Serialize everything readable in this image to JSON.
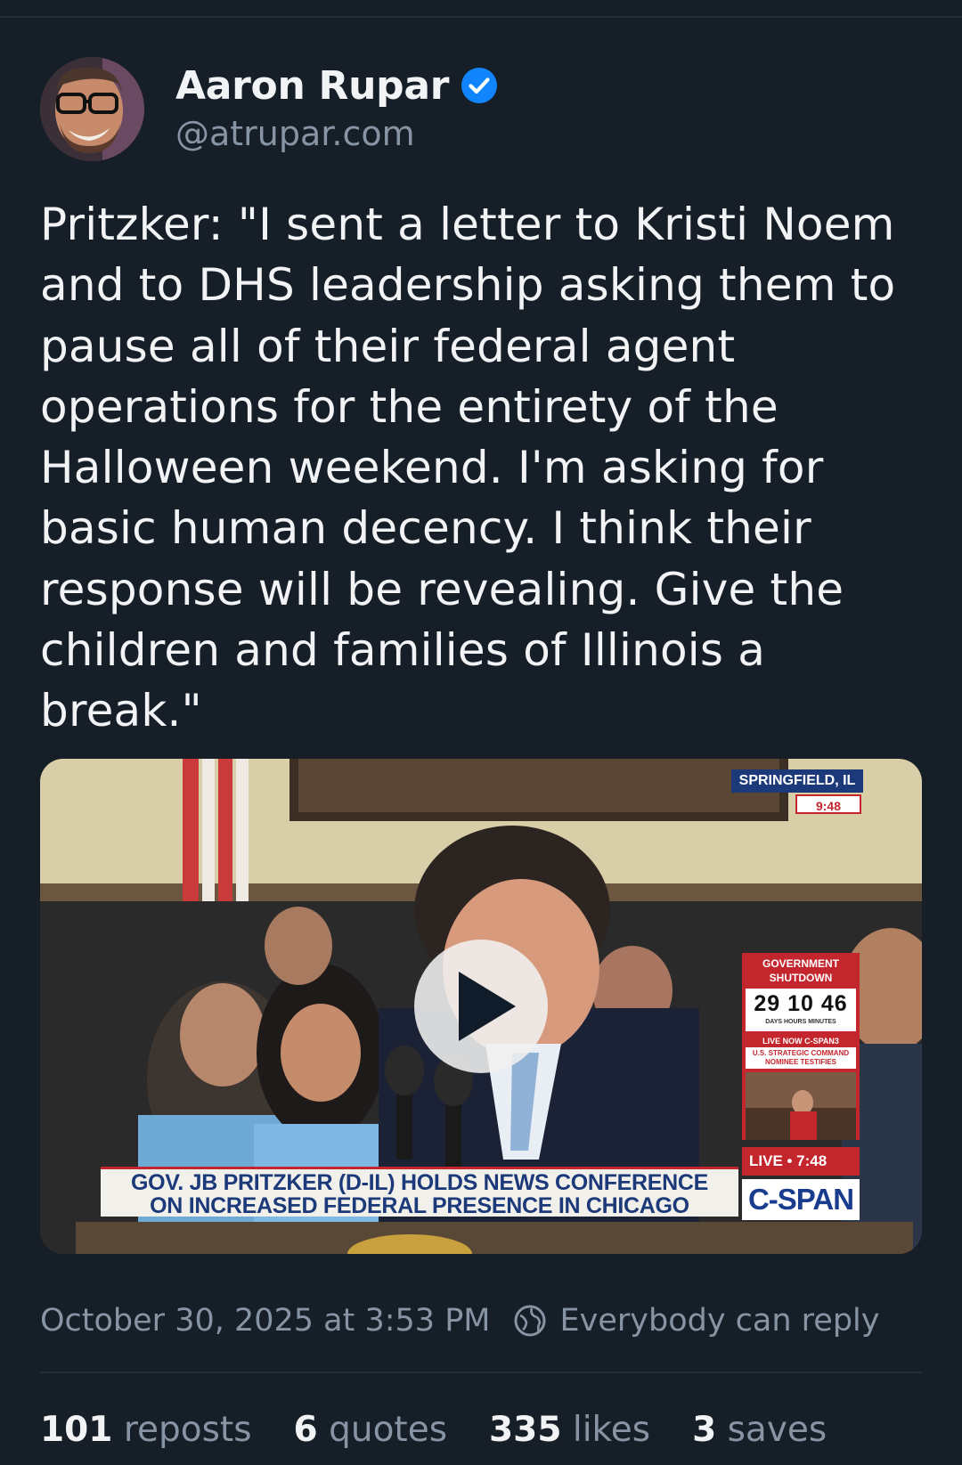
{
  "author": {
    "display_name": "Aaron Rupar",
    "handle": "@atrupar.com",
    "verified": true
  },
  "post": {
    "text": "Pritzker: \"I sent a letter to Kristi Noem and to DHS leadership asking them to pause all of their federal agent operations for the entirety of the Halloween weekend. I'm asking for basic human decency. I think their response will be revealing. Give the children and families of Illinois a break.\""
  },
  "video": {
    "location": "SPRINGFIELD, IL",
    "local_time": "9:48",
    "chyron_line1": "GOV. JB PRITZKER (D-IL) HOLDS NEWS CONFERENCE",
    "chyron_line2": "ON INCREASED FEDERAL PRESENCE IN CHICAGO",
    "live_label": "LIVE • 7:48",
    "network": "C-SPAN",
    "shutdown_title": "GOVERNMENT SHUTDOWN",
    "shutdown_count": "29 10 46",
    "shutdown_units": "DAYS HOURS MINUTES",
    "shutdown_live": "LIVE NOW C-SPAN3",
    "shutdown_sub": "U.S. STRATEGIC COMMAND NOMINEE TESTIFIES"
  },
  "meta": {
    "timestamp": "October 30, 2025 at 3:53 PM",
    "reply_setting": "Everybody can reply",
    "reply_icon": "globe-icon"
  },
  "stats": [
    {
      "count": "101",
      "label": "reposts"
    },
    {
      "count": "6",
      "label": "quotes"
    },
    {
      "count": "335",
      "label": "likes"
    },
    {
      "count": "3",
      "label": "saves"
    }
  ],
  "colors": {
    "background": "#161e27",
    "text": "#f1f3f5",
    "muted": "#8794a3",
    "verified": "#1185fe",
    "divider": "#242e39"
  }
}
